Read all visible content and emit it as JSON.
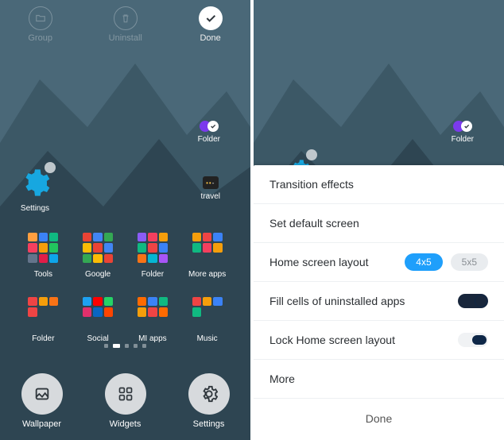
{
  "topbar": {
    "group": "Group",
    "uninstall": "Uninstall",
    "done": "Done"
  },
  "apps": {
    "settings": "Settings",
    "travel": "travel",
    "folder": "Folder"
  },
  "grid": [
    {
      "label": "Tools"
    },
    {
      "label": "Google"
    },
    {
      "label": "Folder"
    },
    {
      "label": "More apps"
    },
    {
      "label": "Folder"
    },
    {
      "label": "Social"
    },
    {
      "label": "MI apps"
    },
    {
      "label": "Music"
    }
  ],
  "actions": {
    "wallpaper": "Wallpaper",
    "widgets": "Widgets",
    "settings": "Settings"
  },
  "sheet": {
    "transition": "Transition effects",
    "default": "Set default screen",
    "layout": "Home screen layout",
    "layout_4x5": "4x5",
    "layout_5x5": "5x5",
    "fill": "Fill cells of uninstalled apps",
    "lock": "Lock Home screen layout",
    "more": "More",
    "done": "Done"
  }
}
